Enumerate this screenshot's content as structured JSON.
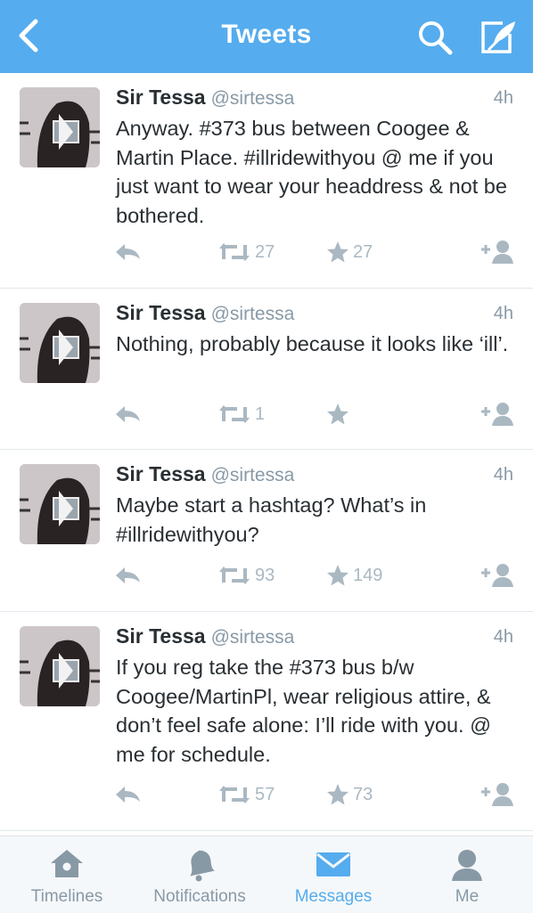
{
  "header": {
    "title": "Tweets",
    "accent": "#55acee",
    "icons": {
      "back": "back-chevron-icon",
      "search": "search-icon",
      "compose": "compose-icon"
    }
  },
  "tweets": [
    {
      "name": "Sir Tessa",
      "handle": "@sirtessa",
      "time": "4h",
      "text": "Anyway. #373 bus between Coogee & Martin Place. #illridewithyou @ me if you just want to wear your headdress & not be bothered.",
      "retweets": "27",
      "favorites": "27"
    },
    {
      "name": "Sir Tessa",
      "handle": "@sirtessa",
      "time": "4h",
      "text": "Nothing, probably because it looks like ‘ill’.",
      "retweets": "1",
      "favorites": ""
    },
    {
      "name": "Sir Tessa",
      "handle": "@sirtessa",
      "time": "4h",
      "text": "Maybe start a hashtag? What’s in #illridewithyou?",
      "retweets": "93",
      "favorites": "149"
    },
    {
      "name": "Sir Tessa",
      "handle": "@sirtessa",
      "time": "4h",
      "text": "If you reg take the #373 bus b/w Coogee/MartinPl, wear religious attire, & don’t feel safe alone: I’ll ride with you. @ me for schedule.",
      "retweets": "57",
      "favorites": "73"
    }
  ],
  "tabbar": {
    "active": "Messages",
    "tabs": [
      {
        "label": "Timelines",
        "icon": "home-icon"
      },
      {
        "label": "Notifications",
        "icon": "bell-icon"
      },
      {
        "label": "Messages",
        "icon": "envelope-icon"
      },
      {
        "label": "Me",
        "icon": "person-icon"
      }
    ]
  },
  "colors": {
    "text": "#292f33",
    "muted": "#8899a6",
    "action": "#aab8c2",
    "accent": "#55acee"
  }
}
